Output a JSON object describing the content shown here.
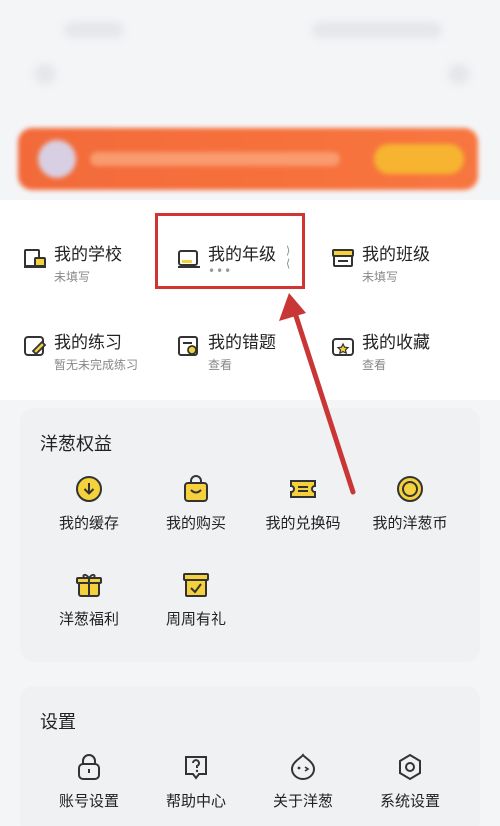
{
  "profile": {
    "school": {
      "title": "我的学校",
      "sub": "未填写"
    },
    "grade": {
      "title": "我的年级",
      "sub": "•••"
    },
    "class": {
      "title": "我的班级",
      "sub": "未填写"
    },
    "practice": {
      "title": "我的练习",
      "sub": "暂无未完成练习"
    },
    "mistakes": {
      "title": "我的错题",
      "sub": "查看"
    },
    "favorites": {
      "title": "我的收藏",
      "sub": "查看"
    }
  },
  "benefits": {
    "title": "洋葱权益",
    "items": [
      {
        "label": "我的缓存",
        "icon": "download-icon"
      },
      {
        "label": "我的购买",
        "icon": "shopping-bag-icon"
      },
      {
        "label": "我的兑换码",
        "icon": "ticket-icon"
      },
      {
        "label": "我的洋葱币",
        "icon": "coin-icon"
      },
      {
        "label": "洋葱福利",
        "icon": "gift-icon"
      },
      {
        "label": "周周有礼",
        "icon": "reward-box-icon"
      }
    ]
  },
  "settings": {
    "title": "设置",
    "items": [
      {
        "label": "账号设置",
        "icon": "lock-icon"
      },
      {
        "label": "帮助中心",
        "icon": "help-icon"
      },
      {
        "label": "关于洋葱",
        "icon": "onion-face-icon"
      },
      {
        "label": "系统设置",
        "icon": "settings-hex-icon"
      }
    ]
  },
  "colors": {
    "accent_yellow": "#f5d13d",
    "icon_stroke": "#333333",
    "highlight_red": "#d23434",
    "banner_orange": "#f26a3a"
  }
}
